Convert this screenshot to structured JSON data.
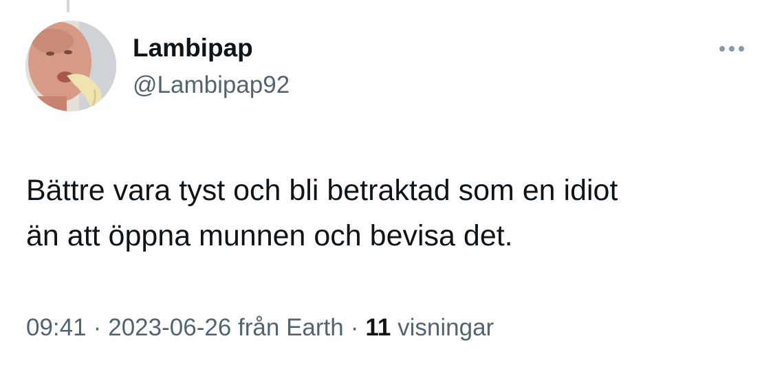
{
  "tweet": {
    "author": {
      "display_name": "Lambipap",
      "handle": "@Lambipap92",
      "avatar_icon": "profile-photo"
    },
    "text_line1": "Bättre vara tyst och bli betraktad som en idiot",
    "text_line2": "än att öppna munnen och bevisa det.",
    "meta": {
      "time": "09:41",
      "separator": "·",
      "date": "2023-06-26",
      "source": "från Earth",
      "views_count": "11",
      "views_label": "visningar"
    },
    "more_icon": "more-horizontal-icon"
  },
  "colors": {
    "text": "#0f1419",
    "secondary": "#536471",
    "icon": "#8b98a5",
    "thread_line": "#cfd9de"
  }
}
